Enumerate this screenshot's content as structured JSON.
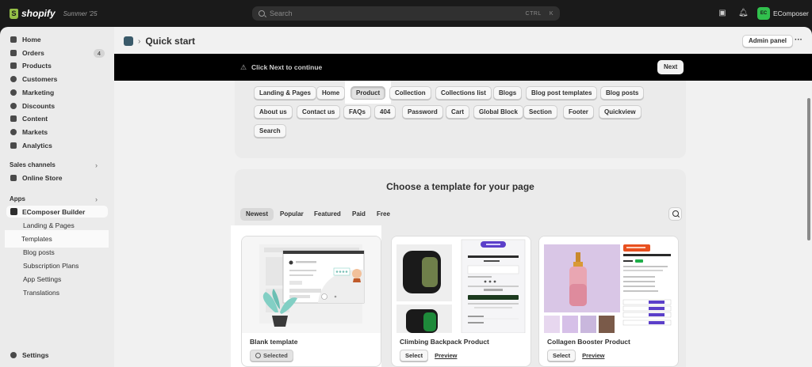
{
  "topbar": {
    "brand": "shopify",
    "edition": "Summer '25",
    "search_placeholder": "Search",
    "shortcut_ctrl": "CTRL",
    "shortcut_key": "K",
    "account_initials": "EC",
    "account_name": "EComposer"
  },
  "sidebar": {
    "items": [
      {
        "label": "Home"
      },
      {
        "label": "Orders",
        "badge": "4"
      },
      {
        "label": "Products"
      },
      {
        "label": "Customers"
      },
      {
        "label": "Marketing"
      },
      {
        "label": "Discounts"
      },
      {
        "label": "Content"
      },
      {
        "label": "Markets"
      },
      {
        "label": "Analytics"
      }
    ],
    "sales_channels_label": "Sales channels",
    "online_store": "Online Store",
    "apps_label": "Apps",
    "app_name": "EComposer Builder",
    "app_subitems": [
      "Landing & Pages",
      "Templates",
      "Blog posts",
      "Subscription Plans",
      "App Settings",
      "Translations"
    ],
    "settings": "Settings"
  },
  "main": {
    "title": "Quick start",
    "admin_panel": "Admin panel",
    "banner_message": "Click Next to continue",
    "next_label": "Next",
    "page_types": [
      "Landing & Pages",
      "Home",
      "Product",
      "Collection",
      "Collections list",
      "Blogs",
      "Blog post templates",
      "Blog posts",
      "About us",
      "Contact us",
      "FAQs",
      "404",
      "Password",
      "Cart",
      "Global Block",
      "Section",
      "Footer",
      "Quickview",
      "Search"
    ],
    "selected_page_type": "Product",
    "template_heading": "Choose a template for your page",
    "tabs": [
      "Newest",
      "Popular",
      "Featured",
      "Paid",
      "Free"
    ],
    "active_tab": "Newest",
    "templates": [
      {
        "name": "Blank template",
        "action": "Selected"
      },
      {
        "name": "Climbing Backpack Product",
        "action": "Select",
        "preview": "Preview",
        "product_title": "Climbing Backpack",
        "price": "$99.00"
      },
      {
        "name": "Collagen Booster Product",
        "action": "Select",
        "preview": "Preview",
        "product_title": "Collagen Booster Gel Serum",
        "price": "$99.00"
      }
    ]
  },
  "colors": {
    "topbar_bg": "#1a1a1a",
    "brand_green": "#95bf47",
    "banner_bg": "#000000",
    "purple_accent": "#5b3fc9",
    "orange_badge": "#e8501f"
  }
}
